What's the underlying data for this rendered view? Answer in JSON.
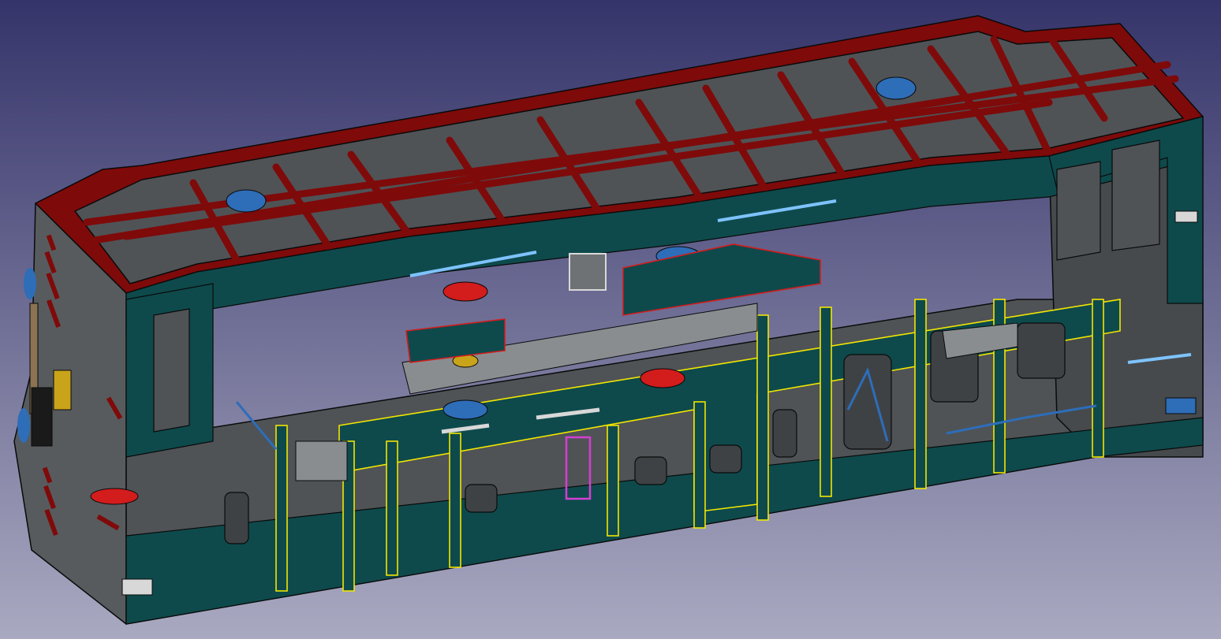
{
  "viewport": {
    "background_top": "#35346a",
    "background_bottom": "#a9a9c1"
  },
  "model": {
    "name": "die-casting-mold-section-view",
    "colors": {
      "body_face": "#4f5356",
      "body_dark": "#3e4245",
      "body_light": "#5d6265",
      "section_face": "#0e4a4c",
      "top_cut": "#7f0a0a",
      "outline": "#0a0a0a",
      "highlight_yellow": "#f2e600",
      "highlight_red": "#d31c1c",
      "highlight_magenta": "#d43fd0",
      "blue_part": "#2e6db8",
      "light_blue_part": "#7ec3ff",
      "white_part": "#d8d8d8",
      "brown_rod": "#8b7353",
      "gold_part": "#c9a31a"
    },
    "engraved_text_color": "#7f0a0a"
  }
}
